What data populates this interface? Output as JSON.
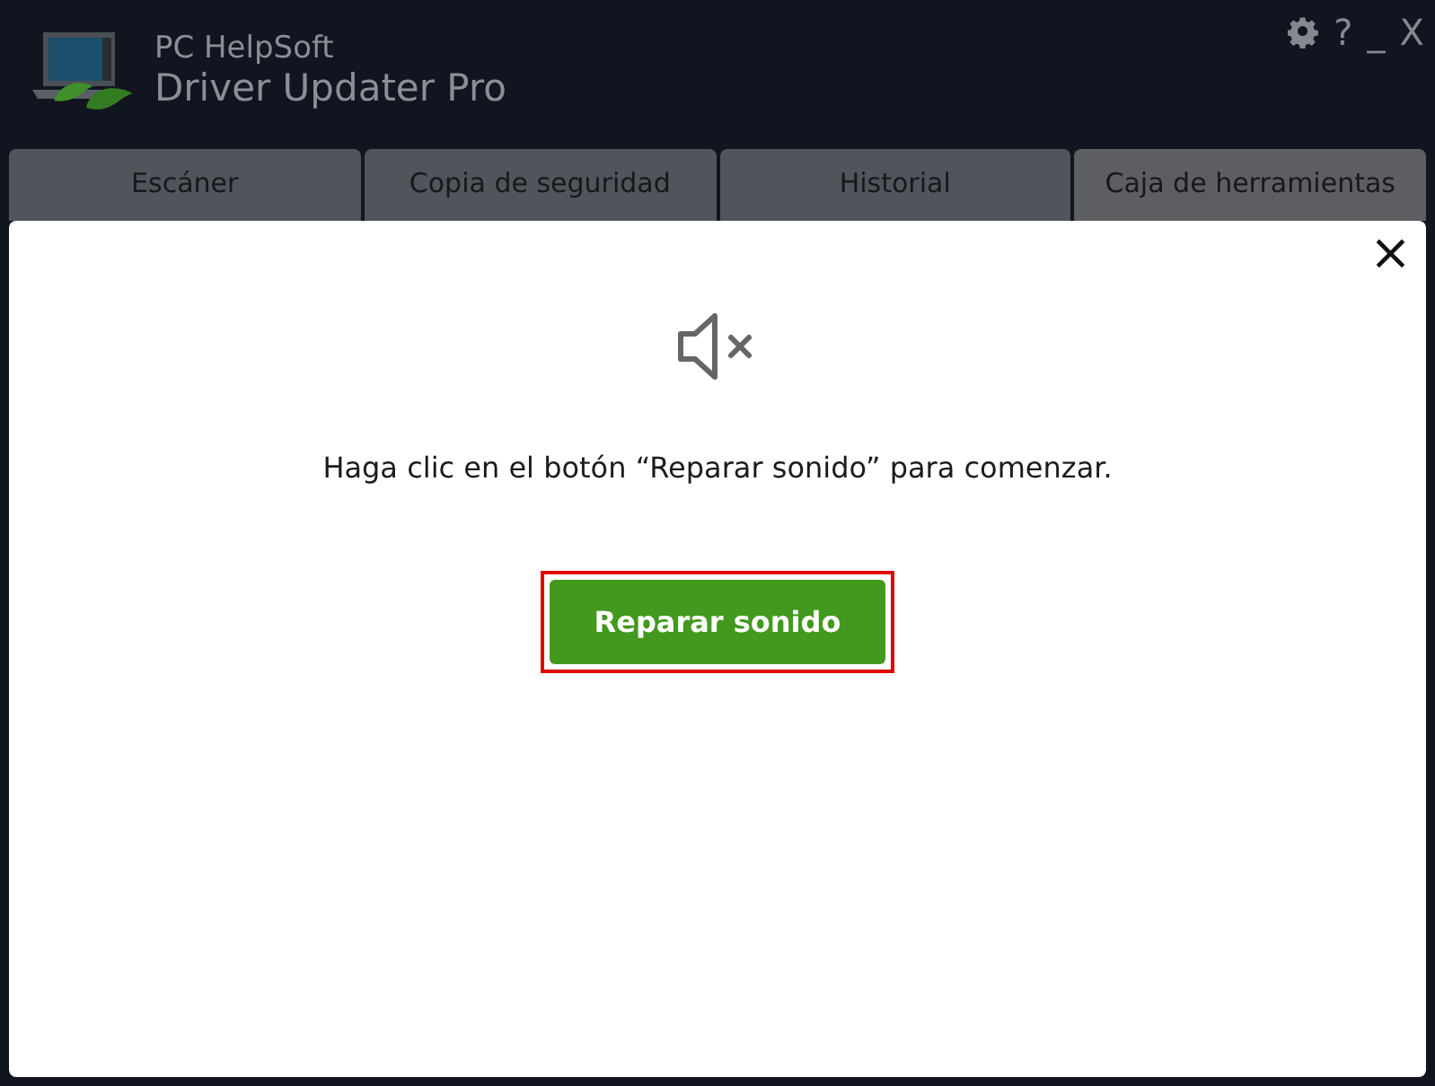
{
  "app": {
    "vendor": "PC HelpSoft",
    "product": "Driver Updater Pro"
  },
  "window_controls": {
    "help": "?",
    "minimize": "_",
    "close": "X"
  },
  "tabs": [
    {
      "label": "Escáner",
      "selected": false
    },
    {
      "label": "Copia de seguridad",
      "selected": false
    },
    {
      "label": "Historial",
      "selected": false
    },
    {
      "label": "Caja de herramientas",
      "selected": true
    }
  ],
  "dialog": {
    "close": "×",
    "message": "Haga clic en el botón “Reparar sonido” para comenzar.",
    "button": {
      "label": "Reparar sonido",
      "highlighted": true
    }
  }
}
